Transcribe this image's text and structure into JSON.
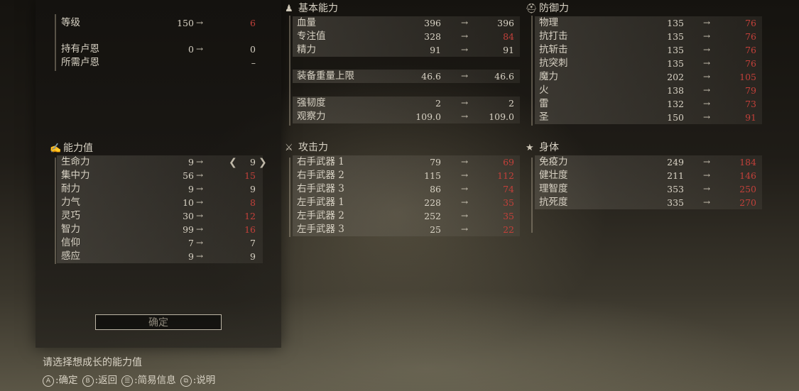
{
  "level": {
    "label": "等级",
    "current": "150",
    "next": "6"
  },
  "runes": [
    {
      "label": "持有卢恩",
      "current": "0",
      "next": "0"
    },
    {
      "label": "所需卢恩",
      "current": "",
      "next": "–"
    }
  ],
  "attributes_title": "能力值",
  "attributes": [
    {
      "label": "生命力",
      "current": "9",
      "next": "9",
      "red": false
    },
    {
      "label": "集中力",
      "current": "56",
      "next": "15",
      "red": true
    },
    {
      "label": "耐力",
      "current": "9",
      "next": "9",
      "red": false
    },
    {
      "label": "力气",
      "current": "10",
      "next": "8",
      "red": true
    },
    {
      "label": "灵巧",
      "current": "30",
      "next": "12",
      "red": true
    },
    {
      "label": "智力",
      "current": "99",
      "next": "16",
      "red": true
    },
    {
      "label": "信仰",
      "current": "7",
      "next": "7",
      "red": false
    },
    {
      "label": "感应",
      "current": "9",
      "next": "9",
      "red": false
    }
  ],
  "confirm_label": "确定",
  "base_title": "基本能力",
  "base": [
    {
      "label": "血量",
      "current": "396",
      "next": "396",
      "red": false
    },
    {
      "label": "专注值",
      "current": "328",
      "next": "84",
      "red": true
    },
    {
      "label": "精力",
      "current": "91",
      "next": "91",
      "red": false
    },
    {
      "label": "装备重量上限",
      "current": "46.6",
      "next": "46.6",
      "red": false
    },
    {
      "label": "强韧度",
      "current": "2",
      "next": "2",
      "red": false
    },
    {
      "label": "观察力",
      "current": "109.0",
      "next": "109.0",
      "red": false
    }
  ],
  "attack_title": "攻击力",
  "attack": [
    {
      "label": "右手武器 1",
      "current": "79",
      "next": "69"
    },
    {
      "label": "右手武器 2",
      "current": "115",
      "next": "112"
    },
    {
      "label": "右手武器 3",
      "current": "86",
      "next": "74"
    },
    {
      "label": "左手武器 1",
      "current": "228",
      "next": "35"
    },
    {
      "label": "左手武器 2",
      "current": "252",
      "next": "35"
    },
    {
      "label": "左手武器 3",
      "current": "25",
      "next": "22"
    }
  ],
  "defense_title": "防御力",
  "defense": [
    {
      "label": "物理",
      "current": "135",
      "next": "76"
    },
    {
      "label": "抗打击",
      "current": "135",
      "next": "76"
    },
    {
      "label": "抗斩击",
      "current": "135",
      "next": "76"
    },
    {
      "label": "抗突刺",
      "current": "135",
      "next": "76"
    },
    {
      "label": "魔力",
      "current": "202",
      "next": "105"
    },
    {
      "label": "火",
      "current": "138",
      "next": "79"
    },
    {
      "label": "雷",
      "current": "132",
      "next": "73"
    },
    {
      "label": "圣",
      "current": "150",
      "next": "91"
    }
  ],
  "body_title": "身体",
  "body": [
    {
      "label": "免疫力",
      "current": "249",
      "next": "184"
    },
    {
      "label": "健壮度",
      "current": "211",
      "next": "146"
    },
    {
      "label": "理智度",
      "current": "353",
      "next": "250"
    },
    {
      "label": "抗死度",
      "current": "335",
      "next": "270"
    }
  ],
  "prompt": "请选择想成长的能力值",
  "hints": [
    {
      "key": "A",
      "label": ":确定"
    },
    {
      "key": "B",
      "label": ":返回"
    },
    {
      "key": "☰",
      "label": ":简易信息"
    },
    {
      "key": "⧉",
      "label": ":说明"
    }
  ],
  "arrow": "→",
  "icons": {
    "attributes": "arm-icon",
    "base": "person-icon",
    "attack": "sword-icon",
    "defense": "helmet-icon",
    "body": "figure-icon",
    "prev": "chevron-left-icon",
    "next": "chevron-right-icon"
  },
  "colors": {
    "decrease": "#c2403a",
    "text": "#d8d2c4"
  }
}
